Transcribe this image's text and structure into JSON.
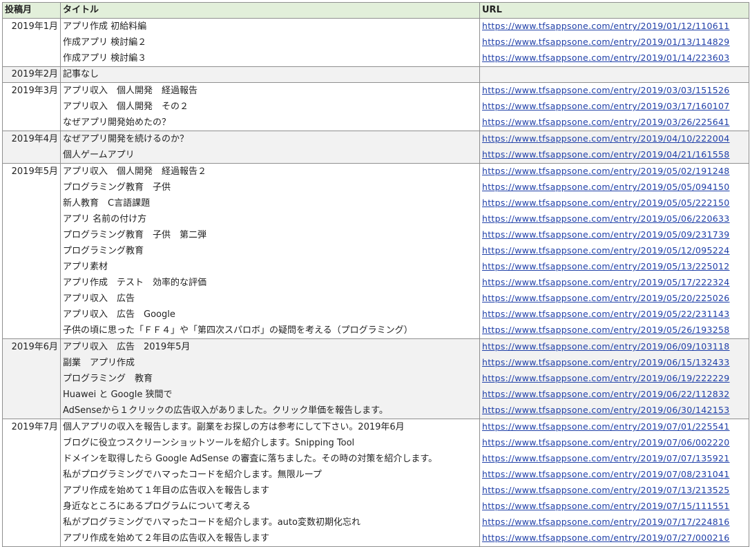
{
  "columns": [
    "投稿月",
    "タイトル",
    "URL"
  ],
  "groups": [
    {
      "month": "2019年1月",
      "shade": false,
      "rows": [
        {
          "title": "アプリ作成 初給料編",
          "url": "https://www.tfsappsone.com/entry/2019/01/12/110611"
        },
        {
          "title": "作成アプリ 検討編２",
          "url": "https://www.tfsappsone.com/entry/2019/01/13/114829"
        },
        {
          "title": "作成アプリ 検討編３",
          "url": "https://www.tfsappsone.com/entry/2019/01/14/223603"
        }
      ]
    },
    {
      "month": "2019年2月",
      "shade": true,
      "rows": [
        {
          "title": "記事なし",
          "url": ""
        }
      ]
    },
    {
      "month": "2019年3月",
      "shade": false,
      "rows": [
        {
          "title": "アプリ収入　個人開発　経過報告",
          "url": "https://www.tfsappsone.com/entry/2019/03/03/151526"
        },
        {
          "title": "アプリ収入　個人開発　その２",
          "url": "https://www.tfsappsone.com/entry/2019/03/17/160107"
        },
        {
          "title": "なぜアプリ開発始めたの？",
          "url": "https://www.tfsappsone.com/entry/2019/03/26/225641"
        }
      ]
    },
    {
      "month": "2019年4月",
      "shade": true,
      "rows": [
        {
          "title": "なぜアプリ開発を続けるのか？",
          "url": "https://www.tfsappsone.com/entry/2019/04/10/222004"
        },
        {
          "title": "個人ゲームアプリ",
          "url": "https://www.tfsappsone.com/entry/2019/04/21/161558"
        }
      ]
    },
    {
      "month": "2019年5月",
      "shade": false,
      "rows": [
        {
          "title": "アプリ収入　個人開発　経過報告２",
          "url": "https://www.tfsappsone.com/entry/2019/05/02/191248"
        },
        {
          "title": "プログラミング教育　子供",
          "url": "https://www.tfsappsone.com/entry/2019/05/05/094150"
        },
        {
          "title": "新人教育　C言語課題",
          "url": "https://www.tfsappsone.com/entry/2019/05/05/222150"
        },
        {
          "title": "アプリ 名前の付け方",
          "url": "https://www.tfsappsone.com/entry/2019/05/06/220633"
        },
        {
          "title": "プログラミング教育　子供　第二弾",
          "url": "https://www.tfsappsone.com/entry/2019/05/09/231739"
        },
        {
          "title": "プログラミング教育",
          "url": "https://www.tfsappsone.com/entry/2019/05/12/095224"
        },
        {
          "title": "アプリ素材",
          "url": "https://www.tfsappsone.com/entry/2019/05/13/225012"
        },
        {
          "title": "アプリ作成　テスト　効率的な評価",
          "url": "https://www.tfsappsone.com/entry/2019/05/17/222324"
        },
        {
          "title": "アプリ収入　広告",
          "url": "https://www.tfsappsone.com/entry/2019/05/20/225026"
        },
        {
          "title": "アプリ収入　広告　Google",
          "url": "https://www.tfsappsone.com/entry/2019/05/22/231143"
        },
        {
          "title": "子供の頃に思った「ＦＦ４」や「第四次スパロボ」の疑問を考える（プログラミング）",
          "url": "https://www.tfsappsone.com/entry/2019/05/26/193258"
        }
      ]
    },
    {
      "month": "2019年6月",
      "shade": true,
      "rows": [
        {
          "title": "アプリ収入　広告　2019年5月",
          "url": "https://www.tfsappsone.com/entry/2019/06/09/103118"
        },
        {
          "title": "副業　アプリ作成",
          "url": "https://www.tfsappsone.com/entry/2019/06/15/132433"
        },
        {
          "title": "プログラミング　教育",
          "url": "https://www.tfsappsone.com/entry/2019/06/19/222229"
        },
        {
          "title": "Huawei と Google 狭間で",
          "url": "https://www.tfsappsone.com/entry/2019/06/22/112832"
        },
        {
          "title": "AdSenseから１クリックの広告収入がありました。クリック単価を報告します。",
          "url": "https://www.tfsappsone.com/entry/2019/06/30/142153"
        }
      ]
    },
    {
      "month": "2019年7月",
      "shade": false,
      "rows": [
        {
          "title": "個人アプリの収入を報告します。副業をお探しの方は参考にして下さい。2019年6月",
          "url": "https://www.tfsappsone.com/entry/2019/07/01/225541"
        },
        {
          "title": "ブログに役立つスクリーンショットツールを紹介します。Snipping Tool",
          "url": "https://www.tfsappsone.com/entry/2019/07/06/002220"
        },
        {
          "title": "ドメインを取得したら Google AdSense の審査に落ちました。その時の対策を紹介します。",
          "url": "https://www.tfsappsone.com/entry/2019/07/07/135921"
        },
        {
          "title": "私がプログラミングでハマったコードを紹介します。無限ループ",
          "url": "https://www.tfsappsone.com/entry/2019/07/08/231041"
        },
        {
          "title": "アプリ作成を始めて１年目の広告収入を報告します",
          "url": "https://www.tfsappsone.com/entry/2019/07/13/213525"
        },
        {
          "title": "身近なところにあるプログラムについて考える",
          "url": "https://www.tfsappsone.com/entry/2019/07/15/111551"
        },
        {
          "title": "私がプログラミングでハマったコードを紹介します。auto変数初期化忘れ",
          "url": "https://www.tfsappsone.com/entry/2019/07/17/224816"
        },
        {
          "title": "アプリ作成を始めて２年目の広告収入を報告します",
          "url": "https://www.tfsappsone.com/entry/2019/07/27/000216"
        }
      ]
    }
  ]
}
